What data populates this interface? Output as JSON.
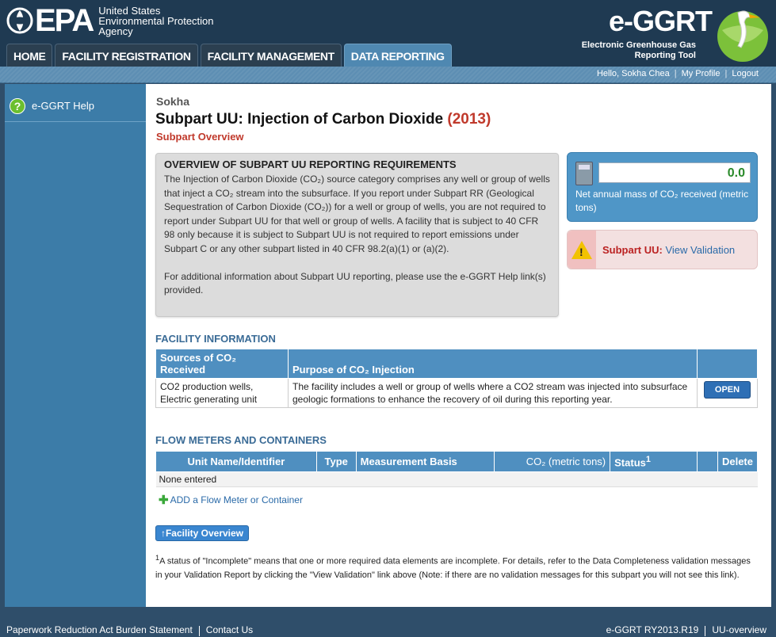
{
  "header": {
    "epa_word": "EPA",
    "epa_agency_lines": [
      "United States",
      "Environmental Protection",
      "Agency"
    ],
    "ggrt_title": "e-GGRT",
    "ggrt_subtitle_lines": [
      "Electronic Greenhouse Gas",
      "Reporting Tool"
    ],
    "nav_tabs": [
      {
        "label": "HOME",
        "active": false
      },
      {
        "label": "FACILITY REGISTRATION",
        "active": false
      },
      {
        "label": "FACILITY MANAGEMENT",
        "active": false
      },
      {
        "label": "DATA REPORTING",
        "active": true
      }
    ],
    "user_links": {
      "greeting": "Hello, Sokha Chea",
      "profile": "My Profile",
      "logout": "Logout"
    }
  },
  "sidebar": {
    "help_label": "e-GGRT Help"
  },
  "main": {
    "facility_name": "Sokha",
    "title": "Subpart UU: Injection of Carbon Dioxide",
    "year": "(2013)",
    "breadcrumb": "Subpart Overview",
    "overview": {
      "heading": "OVERVIEW OF SUBPART UU REPORTING REQUIREMENTS",
      "para1": "The Injection of Carbon Dioxide (CO₂) source category comprises any well or group of wells that inject a CO₂ stream into the subsurface. If you report under Subpart RR (Geological Sequestration of Carbon Dioxide (CO₂)) for a well or group of wells, you are not required to report under Subpart UU for that well or group of wells. A facility that is subject to 40 CFR 98 only because it is subject to Subpart UU is not required to report emissions under Subpart C or any other subpart listed in 40 CFR 98.2(a)(1) or (a)(2).",
      "para2": "For additional information about Subpart UU reporting, please use the e-GGRT Help link(s) provided."
    },
    "mass": {
      "value": "0.0",
      "label": "Net annual mass of CO₂ received (metric tons)"
    },
    "validation": {
      "label": "Subpart UU:",
      "link": "View Validation"
    },
    "facility_info": {
      "title": "FACILITY INFORMATION",
      "headers": [
        "Sources of CO₂ Received",
        "Purpose of CO₂ Injection",
        ""
      ],
      "row": {
        "sources": "CO2 production wells, Electric generating unit",
        "purpose": "The facility includes a well or group of wells where a CO2 stream was injected into subsurface geologic formations to enhance the recovery of oil during this reporting year.",
        "button": "OPEN"
      }
    },
    "flow_meters": {
      "title": "FLOW METERS AND CONTAINERS",
      "headers": [
        "Unit Name/Identifier",
        "Type",
        "Measurement Basis",
        "CO₂ (metric tons)",
        "Status",
        "",
        "Delete"
      ],
      "status_sup": "1",
      "empty": "None entered",
      "add_link": "ADD a Flow Meter or Container"
    },
    "facility_overview_button": "Facility Overview",
    "footnote_sup": "1",
    "footnote": "A status of \"Incomplete\" means that one or more required data elements are incomplete. For details, refer to the Data Completeness validation messages in your Validation Report by clicking the \"View Validation\" link above (Note: if there are no validation messages for this subpart you will not see this link)."
  },
  "footer": {
    "paperwork": "Paperwork Reduction Act Burden Statement",
    "contact": "Contact Us",
    "version": "e-GGRT RY2013.R19",
    "page_id": "UU-overview"
  }
}
